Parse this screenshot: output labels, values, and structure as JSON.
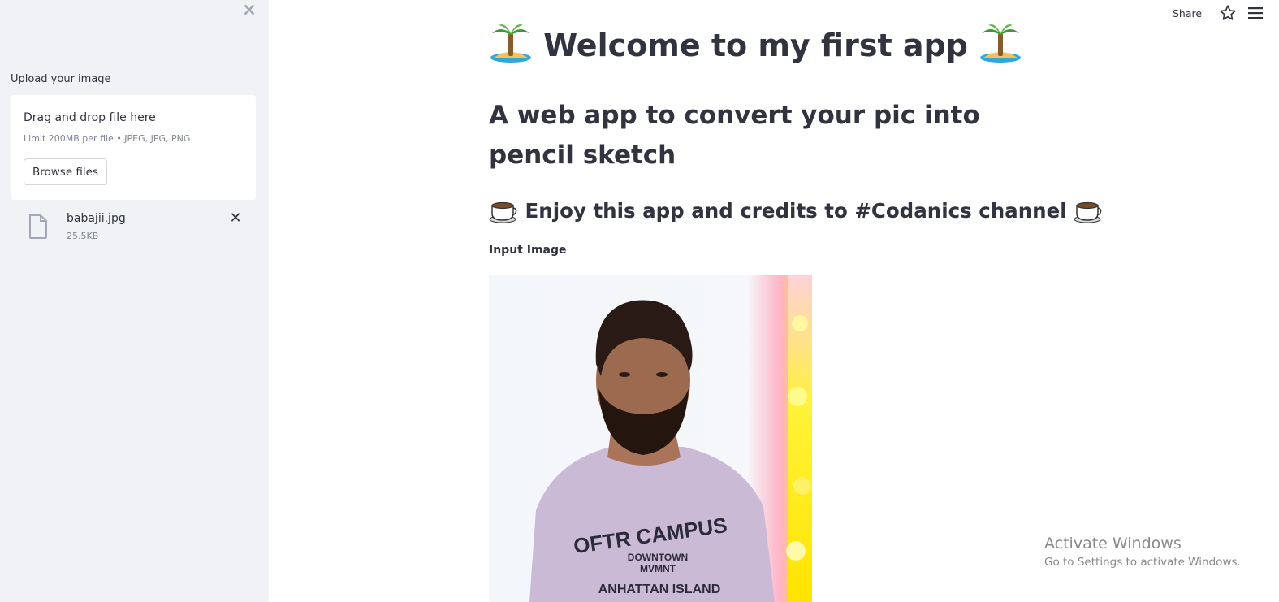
{
  "sidebar": {
    "close_icon": "close-icon",
    "upload_label": "Upload your image",
    "dropzone": {
      "title": "Drag and drop file here",
      "limit": "Limit 200MB per file • JPEG, JPG, PNG",
      "browse_label": "Browse files"
    },
    "file": {
      "name": "babajii.jpg",
      "size": "25.5KB",
      "icon": "file-icon",
      "remove_icon": "close-icon"
    }
  },
  "header": {
    "share_label": "Share",
    "star_icon": "star-icon",
    "menu_icon": "hamburger-menu-icon"
  },
  "main": {
    "title_text": "Welcome to my first app",
    "title_emoji": "desert-island-emoji",
    "subtitle": "A web app to convert your pic into pencil sketch",
    "credits_text": "Enjoy this app and credits to #Codanics channel",
    "credits_emoji": "hot-beverage-emoji",
    "input_label": "Input Image"
  },
  "watermark": {
    "title": "Activate Windows",
    "subtitle": "Go to Settings to activate Windows."
  },
  "colors": {
    "sidebar_bg": "#f0f2f6",
    "text": "#31333f",
    "muted": "#808495",
    "watermark": "#8a8a8a"
  }
}
